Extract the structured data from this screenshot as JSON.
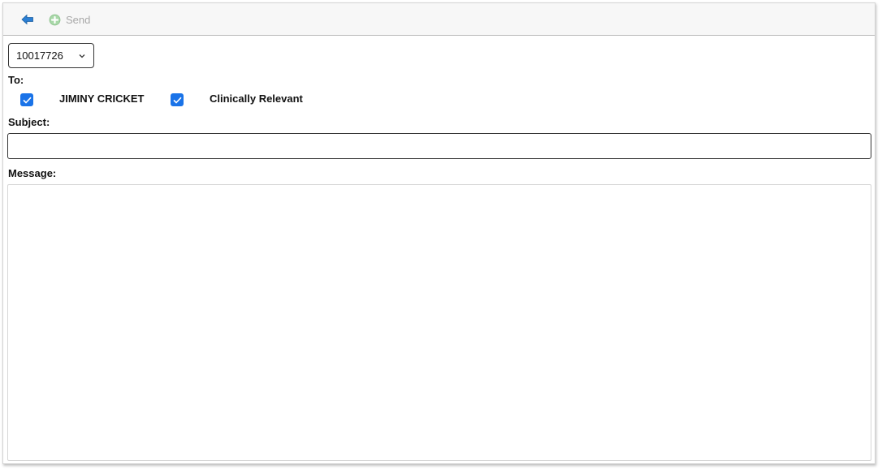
{
  "toolbar": {
    "back_icon": "back-arrow-icon",
    "send_icon": "plus-circle-icon",
    "send_label": "Send"
  },
  "recipient_select": {
    "selected": "10017726"
  },
  "form": {
    "to_label": "To:",
    "recipients": [
      {
        "label": "JIMINY CRICKET",
        "checked": true
      },
      {
        "label": "Clinically Relevant",
        "checked": true
      }
    ],
    "subject_label": "Subject:",
    "subject_value": "",
    "message_label": "Message:",
    "message_value": ""
  },
  "colors": {
    "accent": "#1a73e8",
    "back_arrow": "#2b7fd4",
    "send_icon_disabled": "#a8d8a8",
    "disabled_text": "#a8a8a8"
  }
}
